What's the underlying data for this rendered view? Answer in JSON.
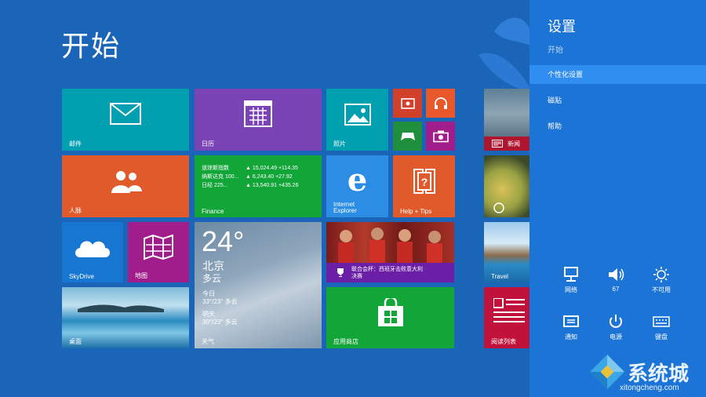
{
  "start": {
    "title": "开始"
  },
  "tiles": {
    "mail": "邮件",
    "calendar": "日历",
    "photos": "照片",
    "people": "人脉",
    "finance": {
      "label": "Finance",
      "rows": [
        {
          "name": "道琼斯指数",
          "value": "▲ 15,024.49 +114.35"
        },
        {
          "name": "纳斯达克 100...",
          "value": "▲ 6,243.40 +27.92"
        },
        {
          "name": "日经 225...",
          "value": "▲ 13,540.91 +435.26"
        }
      ]
    },
    "ie": {
      "line1": "Internet",
      "line2": "Explorer"
    },
    "help": "Help + Tips",
    "skydrive": "SkyDrive",
    "maps": "地图",
    "weather": {
      "temp": "24°",
      "city": "北京",
      "condition": "多云",
      "today_label": "今日",
      "today": "33°/23° 多云",
      "tomorrow_label": "明天",
      "tomorrow": "30°/23° 多云",
      "label": "天气"
    },
    "sports": {
      "headline": "联合会杯：西班牙击败意大利",
      "headline2": "决赛"
    },
    "desktop": "桌面",
    "store": "应用商店",
    "news": "新闻",
    "travel": "Travel",
    "reading": "阅读列表"
  },
  "charm": {
    "title": "设置",
    "subtitle": "开始",
    "items": [
      "个性化设置",
      "磁贴",
      "帮助"
    ],
    "quick": [
      {
        "icon": "network-icon",
        "label": "网络"
      },
      {
        "icon": "volume-icon",
        "label": "67"
      },
      {
        "icon": "brightness-icon",
        "label": "不可用"
      },
      {
        "icon": "notifications-icon",
        "label": "通知"
      },
      {
        "icon": "power-icon",
        "label": "电源"
      },
      {
        "icon": "keyboard-icon",
        "label": "键盘"
      }
    ]
  },
  "watermark": {
    "text": "系统城",
    "url": "xitongcheng.com"
  },
  "colors": {
    "bg": "#1b65b8",
    "charm": "#1b74d6",
    "charm_sel": "#2f8ef0"
  }
}
